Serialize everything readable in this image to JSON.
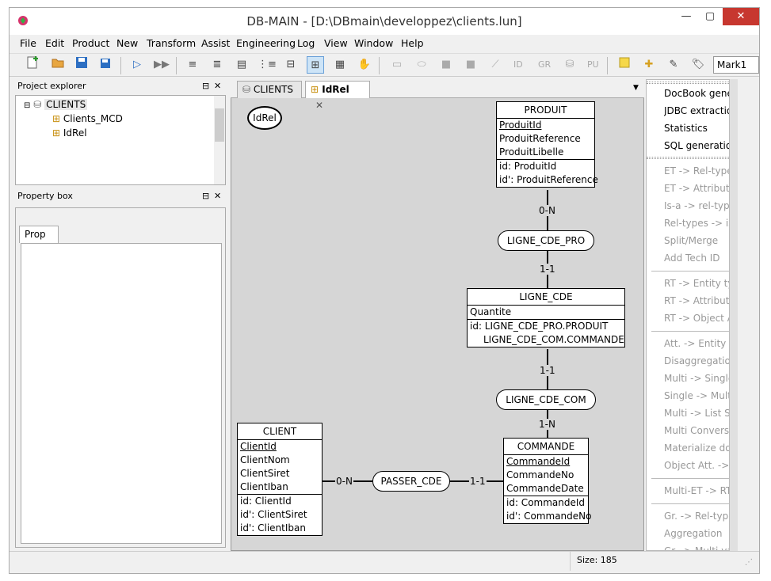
{
  "window": {
    "title": "DB-MAIN  - [D:\\DBmain\\developpez\\clients.lun]",
    "controls": {
      "minimize": "—",
      "maximize": "▢",
      "close": "✕"
    }
  },
  "menubar": [
    "File",
    "Edit",
    "Product",
    "New",
    "Transform",
    "Assist",
    "Engineering",
    "Log",
    "View",
    "Window",
    "Help"
  ],
  "toolbar": {
    "mark_combo": "Mark1",
    "labels": {
      "id": "ID",
      "gr": "GR",
      "pu": "PU"
    }
  },
  "project_explorer": {
    "title": "Project explorer",
    "root": "CLIENTS",
    "children": [
      "Clients_MCD",
      "IdRel"
    ]
  },
  "property_box": {
    "title": "Property box",
    "tab": "Prop"
  },
  "tabs": [
    {
      "label": "CLIENTS"
    },
    {
      "label": "IdRel"
    }
  ],
  "diagram": {
    "schema_label": "IdRel",
    "entities": {
      "produit": {
        "name": "PRODUIT",
        "attributes": [
          "ProduitId",
          "ProduitReference",
          "ProduitLibelle"
        ],
        "ids": [
          "id: ProduitId",
          "id': ProduitReference"
        ]
      },
      "ligne_cde": {
        "name": "LIGNE_CDE",
        "attributes": [
          "Quantite"
        ],
        "ids": [
          "id: LIGNE_CDE_PRO.PRODUIT",
          "LIGNE_CDE_COM.COMMANDE"
        ]
      },
      "commande": {
        "name": "COMMANDE",
        "attributes": [
          "CommandeId",
          "CommandeNo",
          "CommandeDate"
        ],
        "ids": [
          "id: CommandeId",
          "id': CommandeNo"
        ]
      },
      "client": {
        "name": "CLIENT",
        "attributes": [
          "ClientId",
          "ClientNom",
          "ClientSiret",
          "ClientIban"
        ],
        "ids": [
          "id: ClientId",
          "id': ClientSiret",
          "id': ClientIban"
        ]
      }
    },
    "relations": {
      "ligne_cde_pro": {
        "name": "LIGNE_CDE_PRO",
        "card_top": "0-N",
        "card_bottom": "1-1"
      },
      "ligne_cde_com": {
        "name": "LIGNE_CDE_COM",
        "card_top": "1-1",
        "card_bottom": "1-N"
      },
      "passer_cde": {
        "name": "PASSER_CDE",
        "card_left": "0-N",
        "card_right": "1-1"
      }
    }
  },
  "right_panel": {
    "items": [
      "DocBook generation",
      "JDBC extraction",
      "Statistics",
      "SQL generation"
    ],
    "transforms": [
      [
        "ET -> Rel-type",
        "ET -> Attribute",
        "Is-a -> rel-types",
        "Rel-types -> is-a",
        "Split/Merge",
        "Add Tech ID"
      ],
      [
        "RT -> Entity typ",
        "RT -> Attribute",
        "RT -> Object At"
      ],
      [
        "Att. -> Entity typ",
        "Disaggregation",
        "Multi -> Single",
        "Single -> Multi",
        "Multi -> List Sin",
        "Multi Conversio",
        "Materialize dom",
        "Object Att. -> R"
      ],
      [
        "Multi-ET -> RT"
      ],
      [
        "Gr. -> Rel-type",
        "Aggregation",
        "Gr. -> Multi-valu"
      ]
    ]
  },
  "status": {
    "size": "Size: 185"
  }
}
